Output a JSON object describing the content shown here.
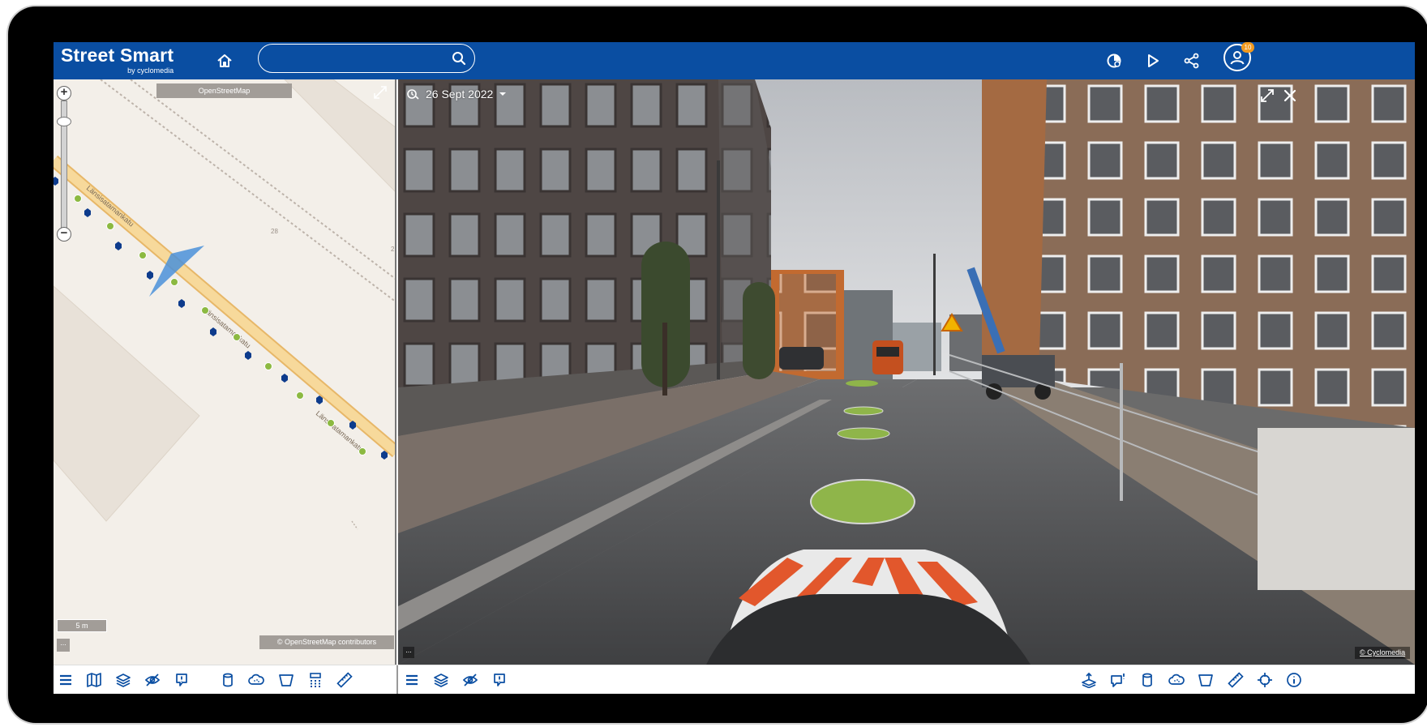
{
  "app": {
    "brand_title": "Street Smart",
    "brand_subtitle": "by cyclomedia",
    "accent_color": "#0a4ea2",
    "notification_badge_color": "#f39a1e"
  },
  "header": {
    "search": {
      "value": "",
      "placeholder": ""
    },
    "notification_count": "10",
    "icons": [
      "home-icon",
      "search-icon",
      "measurement-history-icon",
      "play-icon",
      "share-icon",
      "user-icon"
    ]
  },
  "map": {
    "source_label": "OpenStreetMap",
    "street_labels": [
      "Länsisatamankatu",
      "Länsisatamankatu",
      "Länsisatamankatu"
    ],
    "house_numbers": [
      "28",
      "2"
    ],
    "scale_label": "5 m",
    "more_label": "...",
    "attribution": "© OpenStreetMap contributors"
  },
  "streetview": {
    "capture_date": "26 Sept 2022",
    "copyright": "© Cyclomedia",
    "more_label": "..."
  },
  "map_toolbar": {
    "icons": [
      "menu-icon",
      "map-icon",
      "layers-icon",
      "visibility-off-icon",
      "report-icon",
      "cylinder-icon",
      "cloud-icon",
      "surface-icon",
      "grid-icon",
      "ruler-icon"
    ]
  },
  "streetview_toolbar": {
    "icons": [
      "menu-icon",
      "layers-icon",
      "visibility-off-icon",
      "report-icon",
      "export-icon",
      "annotation-icon",
      "cylinder-icon",
      "cloud-icon",
      "surface-icon",
      "ruler-icon",
      "crosshair-icon",
      "info-icon"
    ]
  }
}
